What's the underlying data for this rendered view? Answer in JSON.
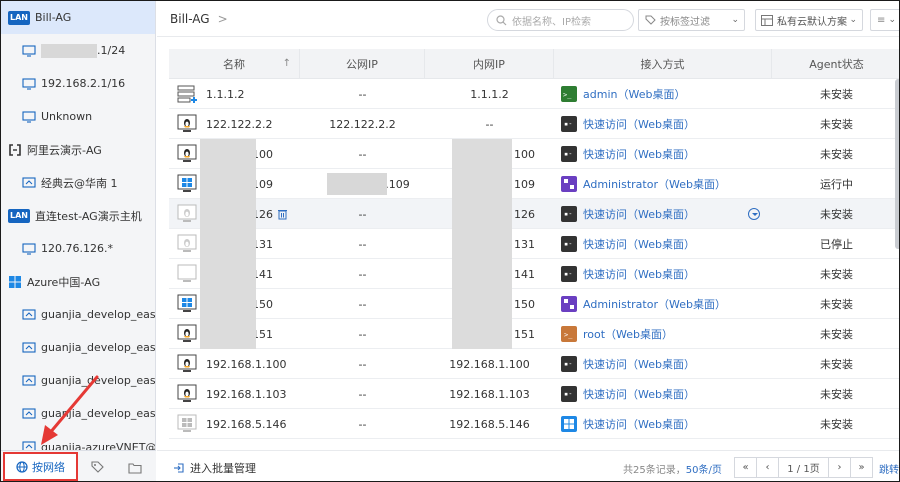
{
  "sidebar": {
    "items": [
      {
        "label": "Bill-AG",
        "type": "lan",
        "level": 1,
        "selected": true
      },
      {
        "label": ".1/24",
        "type": "monitor",
        "level": 2,
        "blurred_prefix": true
      },
      {
        "label": "192.168.2.1/16",
        "type": "monitor",
        "level": 2
      },
      {
        "label": "Unknown",
        "type": "monitor",
        "level": 2
      },
      {
        "label": "阿里云演示-AG",
        "type": "aliyun",
        "level": 1
      },
      {
        "label": "经典云@华南 1",
        "type": "cloud",
        "level": 2
      },
      {
        "label": "直连test-AG演示主机",
        "type": "lan",
        "level": 1
      },
      {
        "label": "120.76.126.*",
        "type": "monitor",
        "level": 2
      },
      {
        "label": "Azure中国-AG",
        "type": "windows",
        "level": 1
      },
      {
        "label": "guanjia_develop_eastvne",
        "type": "cloud",
        "level": 2
      },
      {
        "label": "guanjia_develop_eastvne",
        "type": "cloud",
        "level": 2
      },
      {
        "label": "guanjia_develop_eastvne",
        "type": "cloud",
        "level": 2
      },
      {
        "label": "guanjia_develop_east-vn",
        "type": "cloud",
        "level": 2
      },
      {
        "label": "guanjia-azureVNET@中国",
        "type": "cloud",
        "level": 2
      }
    ],
    "lan_badge": "LAN",
    "tabs": {
      "network": "按网络"
    }
  },
  "header": {
    "breadcrumb": "Bill-AG",
    "breadcrumb_sep": ">",
    "search_placeholder": "依据名称、IP检索",
    "tag_filter": "按标签过滤",
    "scheme": "私有云默认方案"
  },
  "table": {
    "columns": [
      "名称",
      "公网IP",
      "内网IP",
      "接入方式",
      "Agent状态"
    ],
    "sort_indicator": "↑",
    "rows": [
      {
        "os": "server",
        "name": "1.1.1.2",
        "pub": "--",
        "priv": "1.1.1.2",
        "acc_icon": "green",
        "access": "admin（Web桌面）",
        "status": "未安装"
      },
      {
        "os": "linux",
        "name": "122.122.2.2",
        "pub": "122.122.2.2",
        "priv": "--",
        "acc_icon": "terminal",
        "access": "快速访问（Web桌面）",
        "status": "未安装"
      },
      {
        "os": "linux",
        "name": "100",
        "name_blur": true,
        "pub": "--",
        "priv": "100",
        "priv_blur": true,
        "acc_icon": "terminal",
        "access": "快速访问（Web桌面）",
        "status": "未安装"
      },
      {
        "os": "windows",
        "name": "109",
        "name_blur": true,
        "pub": ".109",
        "pub_blur": true,
        "priv": "109",
        "priv_blur": true,
        "acc_icon": "purple",
        "access": "Administrator（Web桌面）",
        "status": "运行中"
      },
      {
        "os": "linux-gray",
        "name": "126",
        "name_blur": true,
        "trash": true,
        "pub": "--",
        "priv": "126",
        "priv_blur": true,
        "acc_icon": "terminal",
        "access": "快速访问（Web桌面）",
        "status": "未安装",
        "highlight": true,
        "dropdown": true
      },
      {
        "os": "linux-gray",
        "name": "131",
        "name_blur": true,
        "pub": "--",
        "priv": "131",
        "priv_blur": true,
        "acc_icon": "terminal",
        "access": "快速访问（Web桌面）",
        "status": "已停止"
      },
      {
        "os": "monitor-blank",
        "name": "141",
        "name_blur": true,
        "pub": "--",
        "priv": "141",
        "priv_blur": true,
        "acc_icon": "terminal",
        "access": "快速访问（Web桌面）",
        "status": "未安装"
      },
      {
        "os": "windows",
        "name": "150",
        "name_blur": true,
        "pub": "--",
        "priv": "150",
        "priv_blur": true,
        "acc_icon": "purple",
        "access": "Administrator（Web桌面）",
        "status": "未安装"
      },
      {
        "os": "linux",
        "name": "151",
        "name_blur": true,
        "pub": "--",
        "priv": "151",
        "priv_blur": true,
        "acc_icon": "orange",
        "access": "root（Web桌面）",
        "status": "未安装"
      },
      {
        "os": "linux",
        "name": "192.168.1.100",
        "pub": "--",
        "priv": "192.168.1.100",
        "acc_icon": "terminal",
        "access": "快速访问（Web桌面）",
        "status": "未安装"
      },
      {
        "os": "linux",
        "name": "192.168.1.103",
        "pub": "--",
        "priv": "192.168.1.103",
        "acc_icon": "terminal",
        "access": "快速访问（Web桌面）",
        "status": "未安装"
      },
      {
        "os": "windows-gray",
        "name": "192.168.5.146",
        "pub": "--",
        "priv": "192.168.5.146",
        "acc_icon": "blue",
        "access": "快速访问（Web桌面）",
        "status": "未安装"
      }
    ]
  },
  "footer": {
    "batch_label": "进入批量管理",
    "total_prefix": "共25条记录，",
    "page_size": "50条/页",
    "page_info": "1 / 1页",
    "jump": "跳转"
  }
}
